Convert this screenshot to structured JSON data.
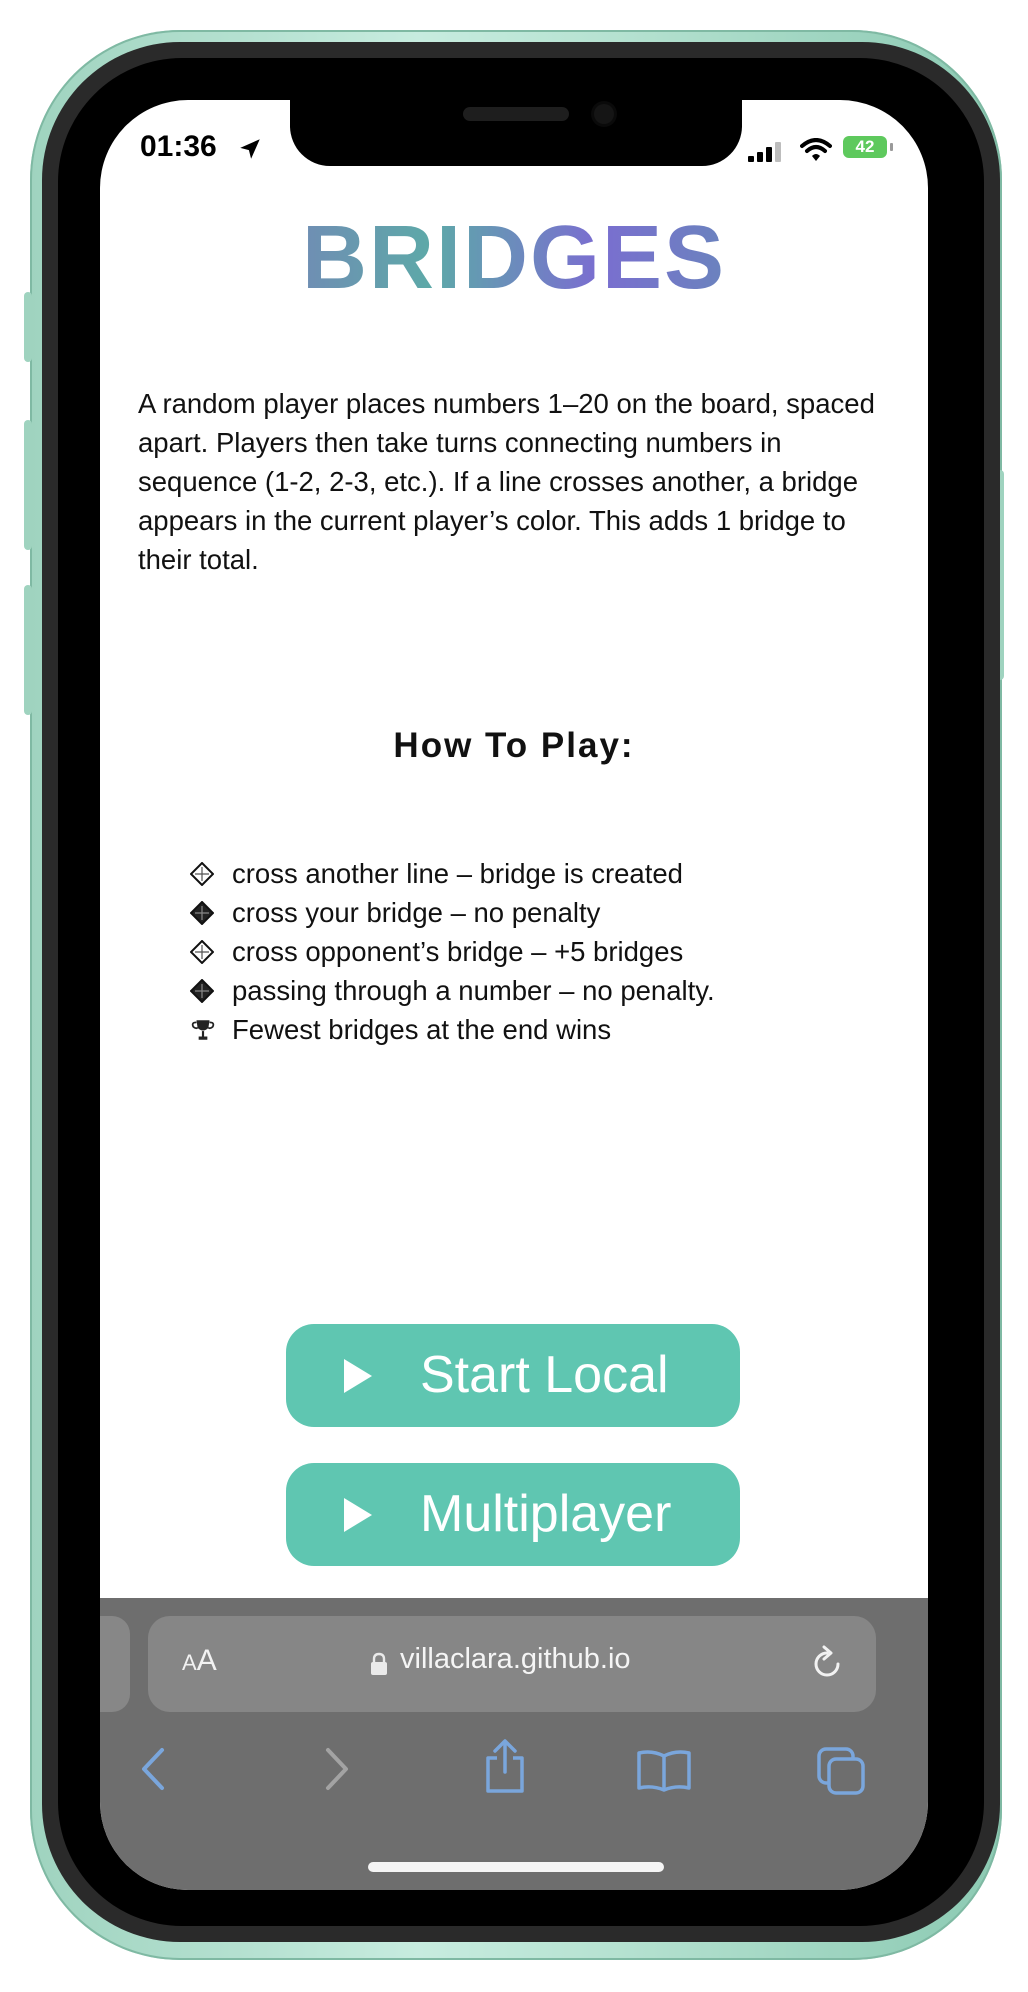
{
  "status": {
    "time": "01:36",
    "battery": "42"
  },
  "page": {
    "title": "BRIDGES",
    "intro": "A random player places numbers 1–20 on the board, spaced apart. Players then take turns connecting numbers in sequence (1-2, 2-3, etc.). If a line crosses another, a bridge appears in the current player’s color. This adds 1 bridge to their total.",
    "how_to_title": "How To Play:",
    "rules": [
      {
        "icon": "diamond-outline-icon",
        "text": "cross another line – bridge is created"
      },
      {
        "icon": "diamond-filled-icon",
        "text": "cross your bridge – no penalty"
      },
      {
        "icon": "diamond-outline-icon",
        "text": "cross opponent’s bridge – +5 bridges"
      },
      {
        "icon": "diamond-filled-icon",
        "text": "passing through a number – no penalty."
      },
      {
        "icon": "trophy-icon",
        "text": " Fewest bridges at the end wins"
      }
    ],
    "buttons": {
      "start_local": "Start Local",
      "multiplayer": "Multiplayer"
    }
  },
  "browser": {
    "text_size_label": "AA",
    "url": "villaclara.github.io"
  },
  "colors": {
    "button": "#5fc6b1",
    "title_purple": "#8c63c6",
    "title_teal": "#5da9a8",
    "toolbar_bg": "#6e6e6e",
    "toolbar_icons": "#7aa6dc",
    "frame": "#9fd3bf"
  }
}
